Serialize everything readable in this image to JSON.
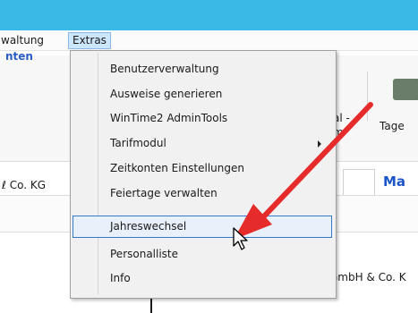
{
  "menubar": {
    "items": [
      "waltung",
      "Extras"
    ]
  },
  "background": {
    "link_text": "nten",
    "ribbon_text_1": "al -",
    "ribbon_text_2": "m",
    "ribbon_tage": "Tage",
    "company_left": "ℓ Co. KG",
    "tab_title": "Ma",
    "company_bottom": "GmbH & Co. K"
  },
  "extras_menu": {
    "items": [
      {
        "label": "Benutzerverwaltung"
      },
      {
        "label": "Ausweise generieren"
      },
      {
        "label": "WinTime2 AdminTools"
      },
      {
        "label": "Tarifmodul",
        "has_submenu": true
      },
      {
        "label": "Zeitkonten Einstellungen"
      },
      {
        "label": "Feiertage verwalten"
      },
      {
        "label": "Jahreswechsel",
        "highlighted": true
      },
      {
        "label": "Personalliste"
      },
      {
        "label": "Info"
      }
    ]
  },
  "colors": {
    "title_bar": "#38b9e6",
    "highlight_border": "#3379d0",
    "annotation_arrow": "#e62b2b",
    "link_blue": "#1b55c7"
  },
  "icons": {
    "cursor": "mouse-pointer-icon",
    "annotation": "red-arrow-icon",
    "submenu": "chevron-right-icon"
  }
}
